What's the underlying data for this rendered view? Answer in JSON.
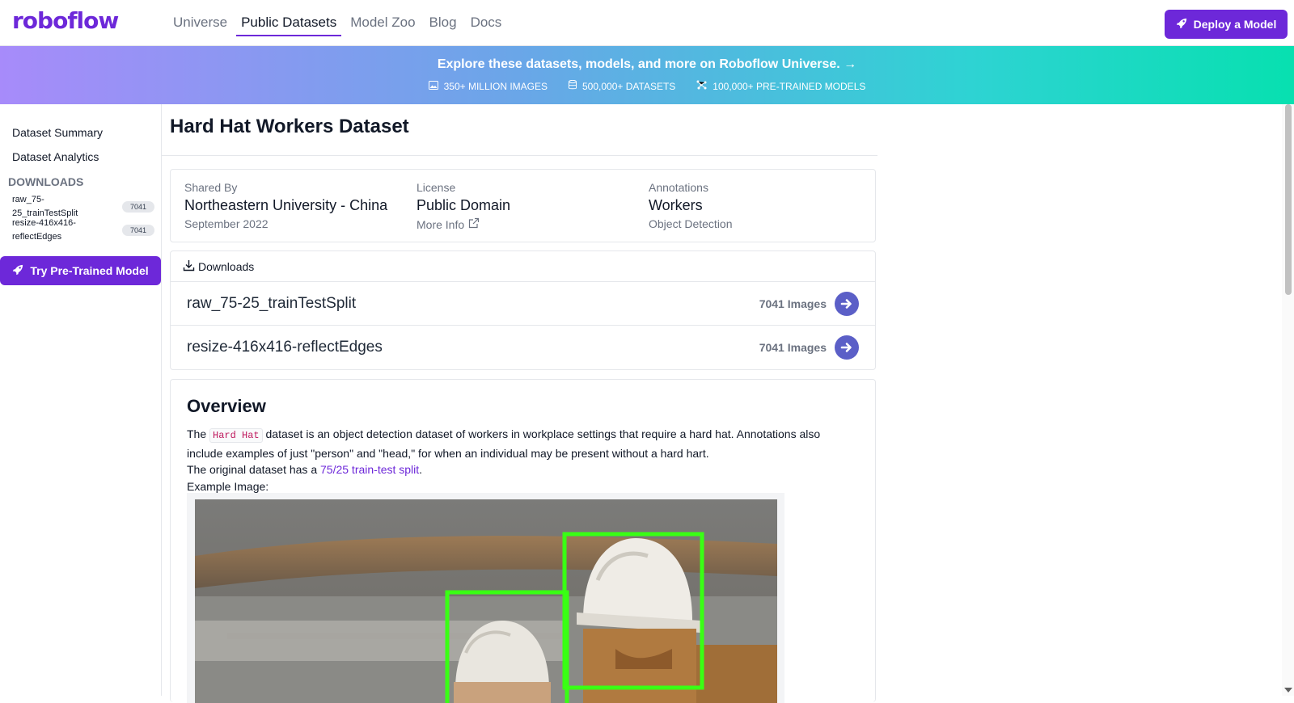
{
  "nav": {
    "logo": "roboflow",
    "links": [
      {
        "label": "Universe"
      },
      {
        "label": "Public Datasets"
      },
      {
        "label": "Model Zoo"
      },
      {
        "label": "Blog"
      },
      {
        "label": "Docs"
      }
    ],
    "active_link": "Public Datasets",
    "deploy_label": "Deploy a Model"
  },
  "banner": {
    "headline": "Explore these datasets, models, and more on Roboflow Universe. →",
    "stats": [
      {
        "icon": "image-icon",
        "label": "350+ MILLION IMAGES"
      },
      {
        "icon": "database-icon",
        "label": "500,000+ DATASETS"
      },
      {
        "icon": "network-icon",
        "label": "100,000+ PRE-TRAINED MODELS"
      }
    ]
  },
  "sidebar": {
    "links": [
      {
        "label": "Dataset Summary"
      },
      {
        "label": "Dataset Analytics"
      }
    ],
    "downloads_heading": "DOWNLOADS",
    "downloads": [
      {
        "name": "raw_75-25_trainTestSplit",
        "count": "7041"
      },
      {
        "name": "resize-416x416-reflectEdges",
        "count": "7041"
      }
    ],
    "try_label": "Try Pre-Trained Model"
  },
  "main": {
    "title": "Hard Hat Workers Dataset",
    "meta": {
      "shared_by": {
        "label": "Shared By",
        "value": "Northeastern University - China",
        "sub": "September 2022"
      },
      "license": {
        "label": "License",
        "value": "Public Domain",
        "sub": "More Info"
      },
      "annotations": {
        "label": "Annotations",
        "value": "Workers",
        "sub": "Object Detection"
      }
    },
    "downloads": {
      "header": "Downloads",
      "rows": [
        {
          "name": "raw_75-25_trainTestSplit",
          "count": "7041 Images"
        },
        {
          "name": "resize-416x416-reflectEdges",
          "count": "7041 Images"
        }
      ]
    },
    "overview": {
      "title": "Overview",
      "p1_before": "The ",
      "p1_code": "Hard Hat",
      "p1_after": " dataset is an object detection dataset of workers in workplace settings that require a hard hat. Annotations also include examples of just \"person\" and \"head,\" for when an individual may be present without a hard hart.",
      "p2_before": "The original dataset has a ",
      "p2_link": "75/25 train-test split",
      "p2_after": ".",
      "p3": "Example Image:"
    }
  },
  "colors": {
    "brand": "#6d28d9",
    "arrow": "#5b5fc7",
    "bbox": "#39ff14"
  }
}
